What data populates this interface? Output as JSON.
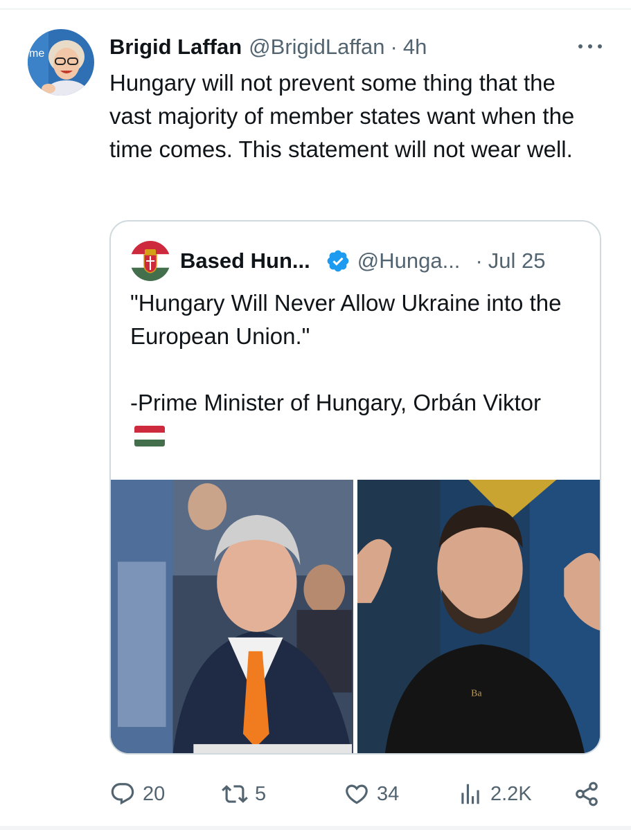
{
  "tweet": {
    "author_name": "Brigid Laffan",
    "author_handle": "@BrigidLaffan",
    "separator": "·",
    "time": "4h",
    "text": "Hungary will not prevent some thing that the vast majority of member states want when the time comes. This statement will not wear well."
  },
  "quoted_tweet": {
    "author_name": "Based Hun...",
    "author_handle": "@Hunga...",
    "separator": "·",
    "date": "Jul 25",
    "text": "\"Hungary Will Never Allow Ukraine into the European Union.\"\n\n-Prime Minister of Hungary, Orbán Viktor",
    "flag_icon": "hungary-flag-icon",
    "verified_color": "#1d9bf0"
  },
  "actions": {
    "replies": "20",
    "retweets": "5",
    "likes": "34",
    "views": "2.2K"
  },
  "colors": {
    "text": "#0f1419",
    "secondary": "#536471",
    "border": "#cfd9de",
    "accent": "#1d9bf0"
  }
}
